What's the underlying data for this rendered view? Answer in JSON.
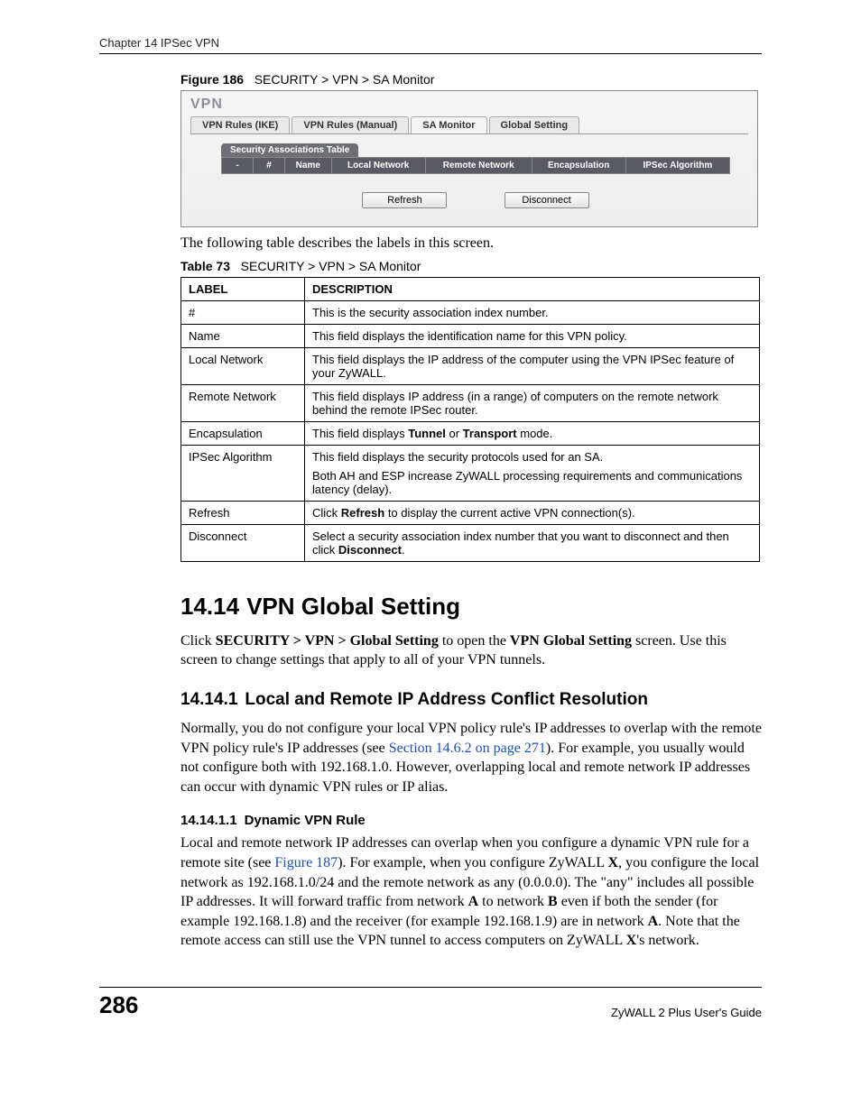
{
  "header": {
    "chapter": "Chapter 14 IPSec VPN"
  },
  "figure": {
    "label": "Figure 186",
    "title": "SECURITY > VPN > SA Monitor"
  },
  "ui": {
    "title": "VPN",
    "tabs": [
      "VPN Rules (IKE)",
      "VPN Rules (Manual)",
      "SA Monitor",
      "Global Setting"
    ],
    "active_tab_index": 2,
    "panel_label": "Security Associations Table",
    "columns": [
      "-",
      "#",
      "Name",
      "Local Network",
      "Remote Network",
      "Encapsulation",
      "IPSec Algorithm"
    ],
    "buttons": {
      "refresh": "Refresh",
      "disconnect": "Disconnect"
    }
  },
  "intro_text": "The following table describes the labels in this screen.",
  "table73": {
    "label": "Table 73",
    "title": "SECURITY > VPN > SA Monitor",
    "head": {
      "label": "LABEL",
      "desc": "DESCRIPTION"
    },
    "rows": [
      {
        "label": "#",
        "desc": "This is the security association index number."
      },
      {
        "label": "Name",
        "desc": "This field displays the identification name for this VPN policy."
      },
      {
        "label": "Local Network",
        "desc": "This field displays the IP address of the computer using the VPN IPSec feature of your ZyWALL."
      },
      {
        "label": "Remote Network",
        "desc": "This field displays IP address (in a range) of computers on the remote network behind the remote IPSec router."
      },
      {
        "label": "Encapsulation",
        "desc_pre": "This field displays ",
        "b1": "Tunnel",
        "mid": " or ",
        "b2": "Transport",
        "desc_post": " mode."
      },
      {
        "label": "IPSec Algorithm",
        "desc": "This field displays the security protocols used for an SA.",
        "desc2": "Both AH and ESP increase ZyWALL processing requirements and communications latency (delay)."
      },
      {
        "label": "Refresh",
        "pre": "Click ",
        "b": "Refresh",
        "post": " to display the current active VPN connection(s)."
      },
      {
        "label": "Disconnect",
        "pre": "Select a security association index number that you want to disconnect and then click ",
        "b": "Disconnect",
        "post": "."
      }
    ]
  },
  "sec_14_14": {
    "num": "14.14",
    "title": "VPN Global Setting",
    "p1_pre": "Click ",
    "p1_b1": "SECURITY > VPN > Global Setting",
    "p1_mid": " to open the ",
    "p1_b2": "VPN Global Setting",
    "p1_post": " screen. Use this screen to change settings that apply to all of your VPN tunnels."
  },
  "sec_14_14_1": {
    "num": "14.14.1",
    "title": "Local and Remote IP Address Conflict Resolution",
    "p_pre": "Normally, you do not configure your local VPN policy rule's IP addresses to overlap with the remote VPN policy rule's IP addresses (see ",
    "link": "Section 14.6.2 on page 271",
    "p_post": "). For example, you usually would not configure both with 192.168.1.0. However, overlapping local and remote network IP addresses can occur with dynamic VPN rules or IP alias."
  },
  "sec_14_14_1_1": {
    "num": "14.14.1.1",
    "title": "Dynamic VPN Rule",
    "p_pre": "Local and remote network IP addresses can overlap when you configure a dynamic VPN rule for a remote site (see ",
    "link": "Figure 187",
    "p_mid1": "). For example, when you configure ZyWALL ",
    "bX1": "X",
    "p_mid2": ", you configure the local network as 192.168.1.0/24 and the remote network as any (0.0.0.0). The \"any\" includes all possible IP addresses. It will forward traffic from network ",
    "bA1": "A",
    "p_mid3": " to network ",
    "bB": "B",
    "p_mid4": " even if both the sender (for example 192.168.1.8) and the receiver (for example 192.168.1.9) are in network ",
    "bA2": "A",
    "p_mid5": ". Note that the remote access can still use the VPN tunnel to access computers on ZyWALL ",
    "bX2": "X",
    "p_post": "'s network."
  },
  "footer": {
    "page": "286",
    "guide": "ZyWALL 2 Plus User's Guide"
  }
}
